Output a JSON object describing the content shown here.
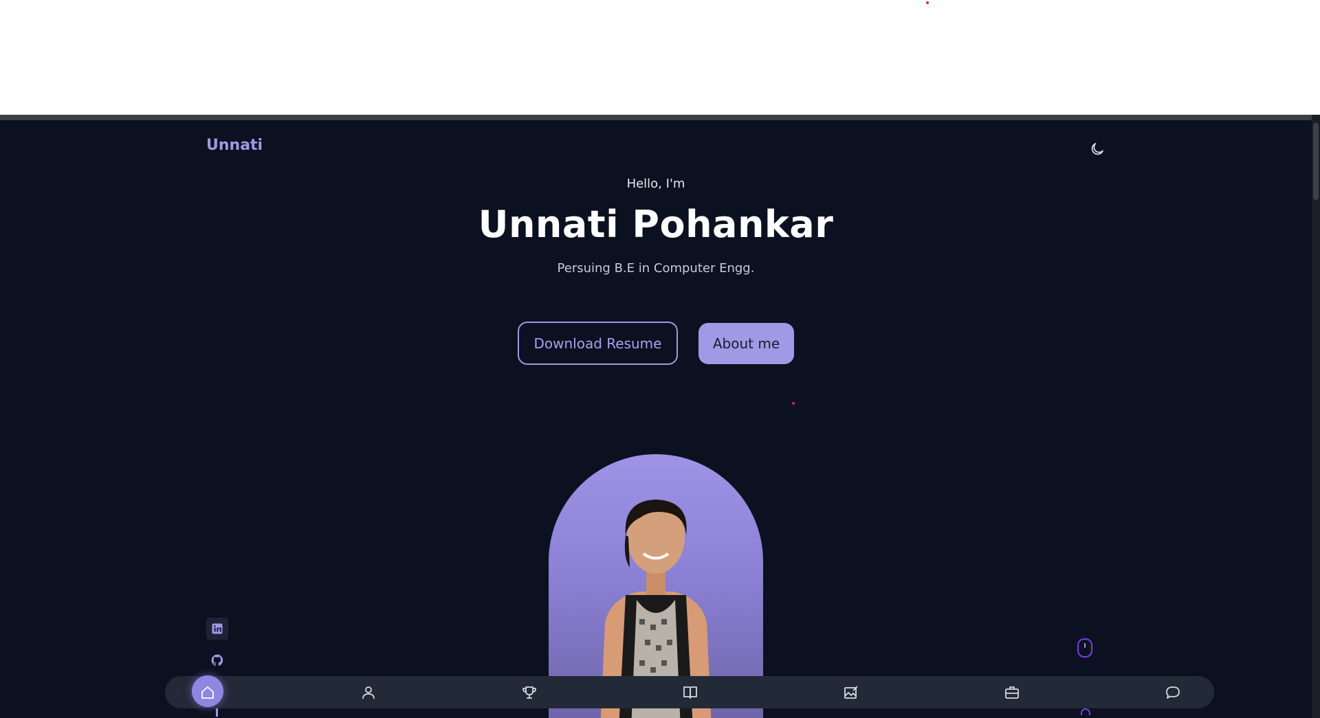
{
  "header": {
    "logo": "Unnati",
    "theme_toggle_icon": "moon-icon"
  },
  "hero": {
    "greeting": "Hello, I'm",
    "name": "Unnati Pohankar",
    "subtitle": "Persuing B.E in Computer Engg.",
    "buttons": {
      "download_resume": "Download Resume",
      "about_me": "About me"
    }
  },
  "social": [
    {
      "icon": "linkedin-icon"
    },
    {
      "icon": "github-icon"
    }
  ],
  "scroll_indicator": {
    "icon": "mouse-icon"
  },
  "bottom_nav": {
    "active": "home",
    "items": [
      {
        "id": "home",
        "icon": "home-icon"
      },
      {
        "id": "about",
        "icon": "user-icon"
      },
      {
        "id": "achievements",
        "icon": "trophy-icon"
      },
      {
        "id": "education",
        "icon": "book-icon"
      },
      {
        "id": "skills",
        "icon": "edit-image-icon"
      },
      {
        "id": "experience",
        "icon": "briefcase-icon"
      },
      {
        "id": "contact",
        "icon": "chat-icon"
      }
    ]
  },
  "colors": {
    "background": "#0b1120",
    "accent": "#a09ae6",
    "nav_background": "#222937",
    "scroll_accent": "#7c3aed"
  }
}
